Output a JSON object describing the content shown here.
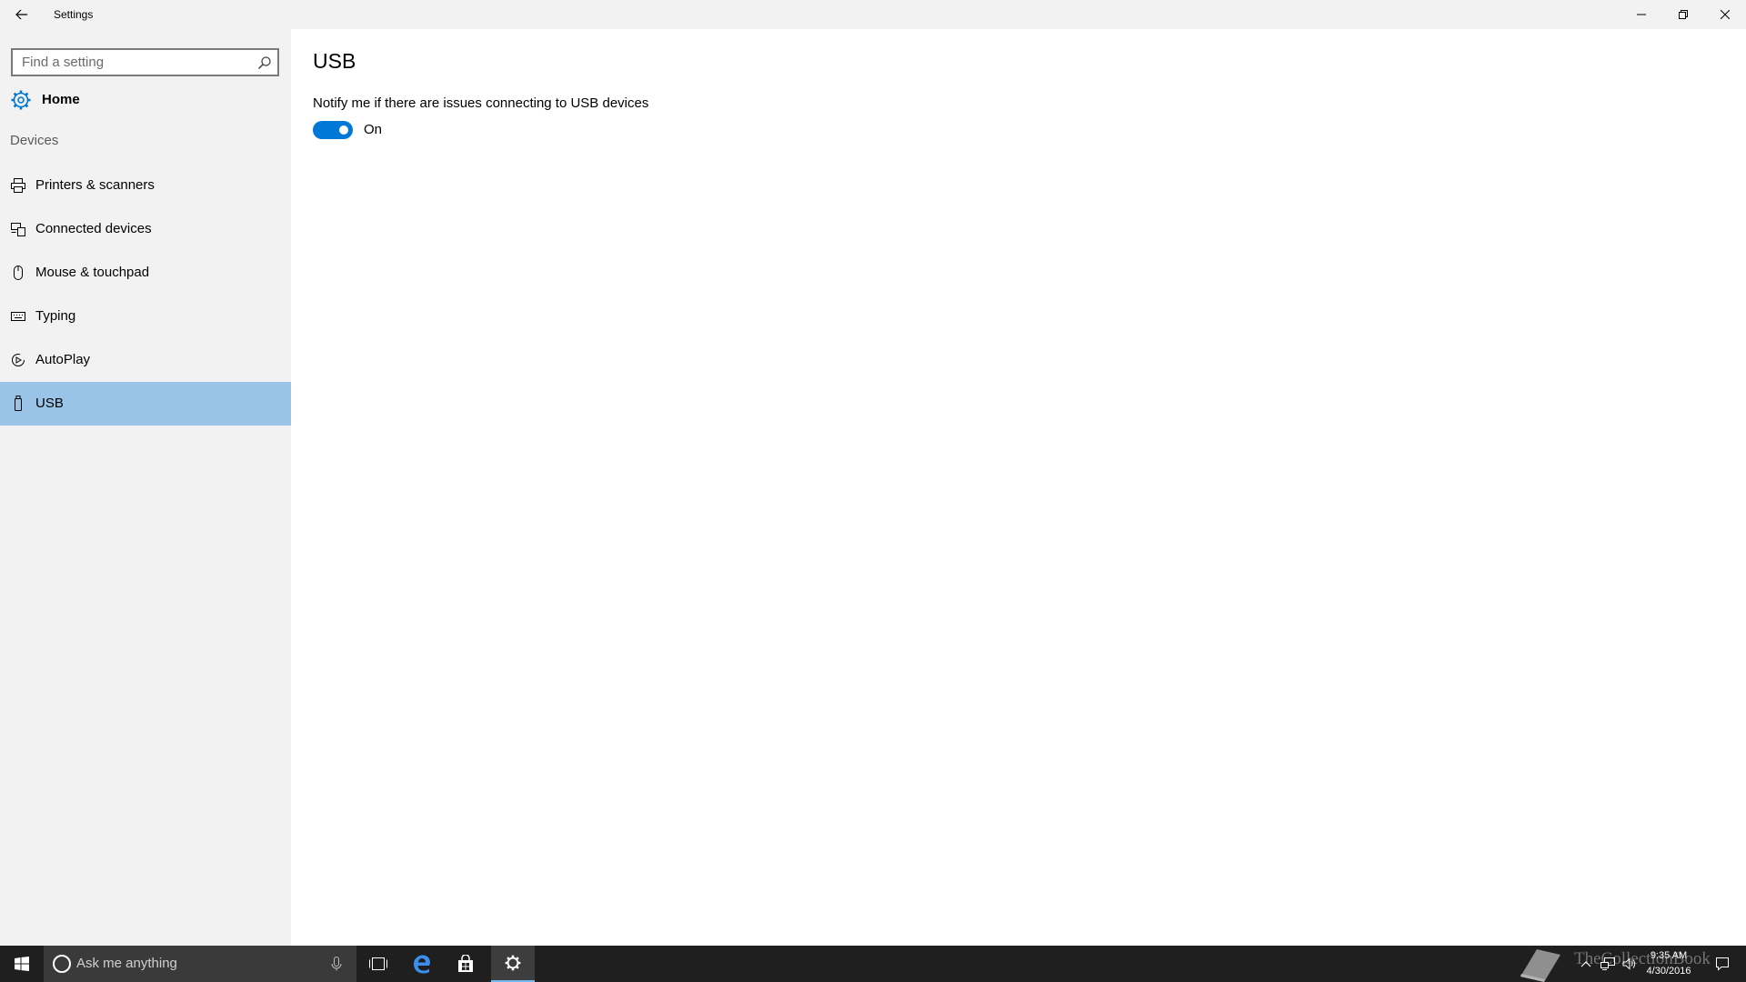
{
  "window": {
    "title": "Settings",
    "back_icon": "back-arrow-icon",
    "minimize_icon": "minimize-icon",
    "restore_icon": "restore-icon",
    "close_icon": "close-icon"
  },
  "sidebar": {
    "search": {
      "placeholder": "Find a setting",
      "icon": "search-icon"
    },
    "home": {
      "label": "Home",
      "icon": "gear-icon"
    },
    "group_label": "Devices",
    "items": [
      {
        "label": "Printers & scanners",
        "icon": "printer-icon",
        "selected": false
      },
      {
        "label": "Connected devices",
        "icon": "connected-devices-icon",
        "selected": false
      },
      {
        "label": "Mouse & touchpad",
        "icon": "mouse-icon",
        "selected": false
      },
      {
        "label": "Typing",
        "icon": "keyboard-icon",
        "selected": false
      },
      {
        "label": "AutoPlay",
        "icon": "autoplay-icon",
        "selected": false
      },
      {
        "label": "USB",
        "icon": "usb-icon",
        "selected": true
      }
    ],
    "selected_color": "#99c4e8"
  },
  "main": {
    "title": "USB",
    "setting": {
      "description": "Notify me if there are issues connecting to USB devices",
      "toggle_state": "On",
      "toggle_on": true,
      "accent": "#0078d7"
    }
  },
  "taskbar": {
    "search_placeholder": "Ask me anything",
    "apps": [
      {
        "name": "task-view",
        "icon": "task-view-icon"
      },
      {
        "name": "edge",
        "icon": "edge-icon"
      },
      {
        "name": "store",
        "icon": "store-icon"
      },
      {
        "name": "settings",
        "icon": "gear-icon",
        "active": true
      }
    ],
    "clock": {
      "time": "9:35 AM",
      "date": "4/30/2016"
    },
    "watermark": "TheCollectionBook"
  }
}
